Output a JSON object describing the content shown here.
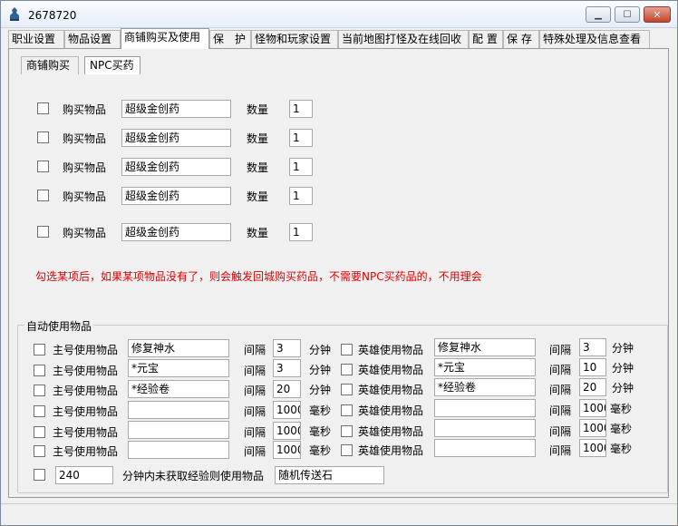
{
  "window": {
    "title": "2678720"
  },
  "tabs": [
    {
      "label": "职业设置"
    },
    {
      "label": "物品设置"
    },
    {
      "label": "商铺购买及使用"
    },
    {
      "label": "保　护"
    },
    {
      "label": "怪物和玩家设置"
    },
    {
      "label": "当前地图打怪及在线回收"
    },
    {
      "label": "配 置"
    },
    {
      "label": "保 存"
    },
    {
      "label": "特殊处理及信息查看"
    }
  ],
  "subtabs": [
    {
      "label": "商铺购买"
    },
    {
      "label": "NPC买药"
    }
  ],
  "buy_rows": [
    {
      "label": "购买物品",
      "item": "超级金创药",
      "qty_label": "数量",
      "qty": "1"
    },
    {
      "label": "购买物品",
      "item": "超级金创药",
      "qty_label": "数量",
      "qty": "1"
    },
    {
      "label": "购买物品",
      "item": "超级金创药",
      "qty_label": "数量",
      "qty": "1"
    },
    {
      "label": "购买物品",
      "item": "超级金创药",
      "qty_label": "数量",
      "qty": "1"
    },
    {
      "label": "购买物品",
      "item": "超级金创药",
      "qty_label": "数量",
      "qty": "1"
    }
  ],
  "note": "勾选某项后，如果某项物品没有了，则会触发回城购买药品，不需要NPC买药品的，不用理会",
  "auto_use": {
    "title": "自动使用物品",
    "rows": [
      {
        "main_label": "主号使用物品",
        "main_item": "修复神水",
        "main_interval_label": "间隔",
        "main_interval": "3",
        "main_unit": "分钟",
        "hero_label": "英雄使用物品",
        "hero_item": "修复神水",
        "hero_interval_label": "间隔",
        "hero_interval": "3",
        "hero_unit": "分钟"
      },
      {
        "main_label": "主号使用物品",
        "main_item": "*元宝",
        "main_interval_label": "间隔",
        "main_interval": "3",
        "main_unit": "分钟",
        "hero_label": "英雄使用物品",
        "hero_item": "*元宝",
        "hero_interval_label": "间隔",
        "hero_interval": "10",
        "hero_unit": "分钟"
      },
      {
        "main_label": "主号使用物品",
        "main_item": "*经验卷",
        "main_interval_label": "间隔",
        "main_interval": "20",
        "main_unit": "分钟",
        "hero_label": "英雄使用物品",
        "hero_item": "*经验卷",
        "hero_interval_label": "间隔",
        "hero_interval": "20",
        "hero_unit": "分钟"
      },
      {
        "main_label": "主号使用物品",
        "main_item": "",
        "main_interval_label": "间隔",
        "main_interval": "1000",
        "main_unit": "毫秒",
        "hero_label": "英雄使用物品",
        "hero_item": "",
        "hero_interval_label": "间隔",
        "hero_interval": "1000",
        "hero_unit": "毫秒"
      },
      {
        "main_label": "主号使用物品",
        "main_item": "",
        "main_interval_label": "间隔",
        "main_interval": "1000",
        "main_unit": "毫秒",
        "hero_label": "英雄使用物品",
        "hero_item": "",
        "hero_interval_label": "间隔",
        "hero_interval": "1000",
        "hero_unit": "毫秒"
      },
      {
        "main_label": "主号使用物品",
        "main_item": "",
        "main_interval_label": "间隔",
        "main_interval": "1000",
        "main_unit": "毫秒",
        "hero_label": "英雄使用物品",
        "hero_item": "",
        "hero_interval_label": "间隔",
        "hero_interval": "1000",
        "hero_unit": "毫秒"
      }
    ],
    "exp_rule": {
      "minutes": "240",
      "label": "分钟内未获取经验则使用物品",
      "item": "随机传送石"
    }
  }
}
